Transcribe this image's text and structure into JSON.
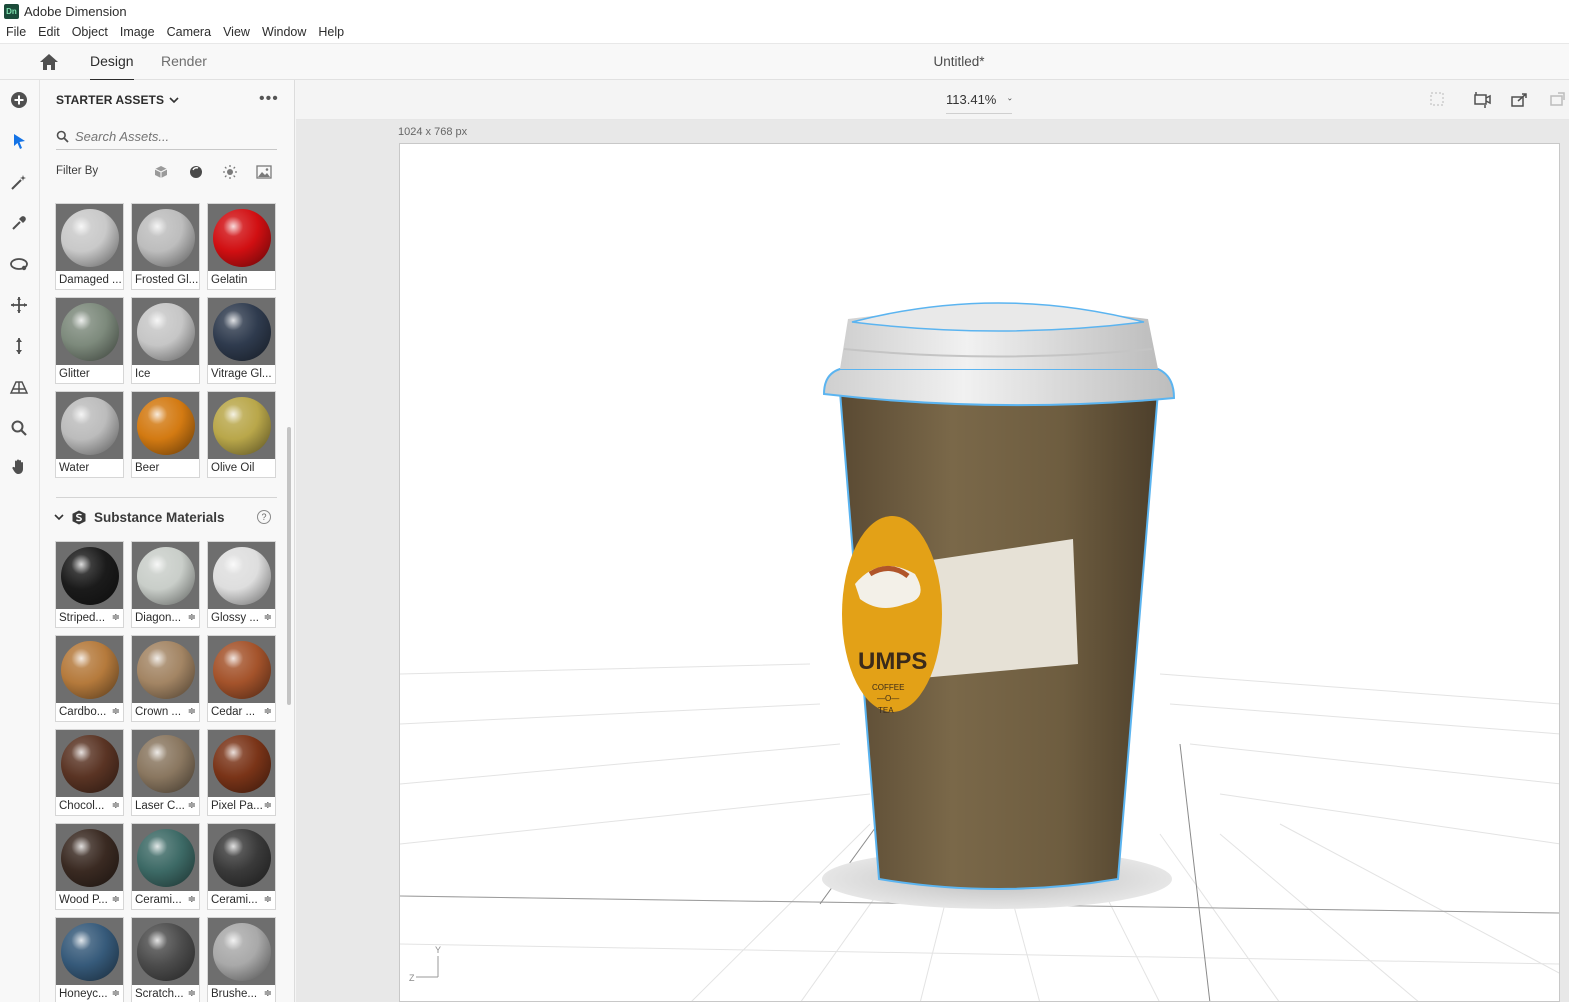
{
  "app": {
    "title": "Adobe Dimension",
    "icon_text": "Dn"
  },
  "menu": [
    "File",
    "Edit",
    "Object",
    "Image",
    "Camera",
    "View",
    "Window",
    "Help"
  ],
  "tabs": {
    "design": "Design",
    "render": "Render"
  },
  "document": {
    "title": "Untitled*"
  },
  "panel": {
    "header": "STARTER ASSETS",
    "search_placeholder": "Search Assets...",
    "filter_label": "Filter By",
    "materials": [
      {
        "label": "Damaged ...",
        "color": "#c9c9c9"
      },
      {
        "label": "Frosted Gl...",
        "color": "#bdbdbd"
      },
      {
        "label": "Gelatin",
        "color": "#d10f12"
      },
      {
        "label": "Glitter",
        "color": "#7d8a7c"
      },
      {
        "label": "Ice",
        "color": "#c6c6c6"
      },
      {
        "label": "Vitrage Gl...",
        "color": "#2f3b4e"
      },
      {
        "label": "Water",
        "color": "#bcbcbc"
      },
      {
        "label": "Beer",
        "color": "#d37a12"
      },
      {
        "label": "Olive Oil",
        "color": "#b9a74a"
      }
    ],
    "section_title": "Substance Materials",
    "substance": [
      {
        "label": "Striped...",
        "color": "#1b1b1b"
      },
      {
        "label": "Diagon...",
        "color": "#c9cec9"
      },
      {
        "label": "Glossy ...",
        "color": "#dedede"
      },
      {
        "label": "Cardbo...",
        "color": "#b57a3c"
      },
      {
        "label": "Crown ...",
        "color": "#a38564"
      },
      {
        "label": "Cedar ...",
        "color": "#a4532b"
      },
      {
        "label": "Chocol...",
        "color": "#5a3424"
      },
      {
        "label": "Laser C...",
        "color": "#8a7760"
      },
      {
        "label": "Pixel Pa...",
        "color": "#7a3418"
      },
      {
        "label": "Wood P...",
        "color": "#3a2a22"
      },
      {
        "label": "Cerami...",
        "color": "#3d6a66"
      },
      {
        "label": "Cerami...",
        "color": "#3a3a3a"
      },
      {
        "label": "Honeyc...",
        "color": "#365a7a"
      },
      {
        "label": "Scratch...",
        "color": "#4c4c4c"
      },
      {
        "label": "Brushe...",
        "color": "#a9a9a9"
      }
    ]
  },
  "viewport": {
    "zoom": "113.41%",
    "canvas_size": "1024 x 768 px"
  },
  "scene": {
    "logo_text": "UMPS",
    "logo_sub1": "COFFEE",
    "logo_sub2": "—O—",
    "logo_sub3": "TEA",
    "axis_y": "Y",
    "axis_z": "Z"
  },
  "colors": {
    "accent": "#1473e6",
    "cup": "#6b5a40",
    "lid": "#e4e4e4",
    "label": "#e3a117"
  }
}
